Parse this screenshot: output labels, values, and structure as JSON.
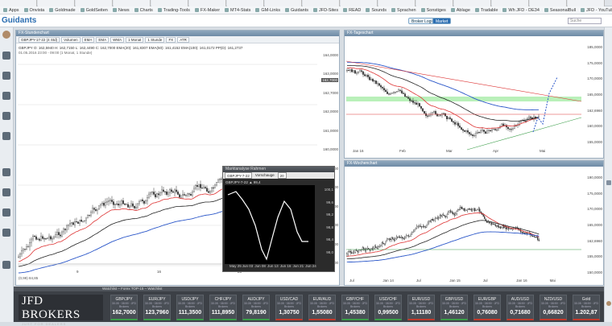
{
  "browser": {
    "tabs": [
      "",
      "",
      "",
      "",
      "",
      "",
      "",
      "",
      "",
      "",
      "",
      "",
      "",
      "",
      "",
      ""
    ],
    "bookmarks": [
      "Apps",
      "Onvista",
      "Goldmade",
      "GoldSeiten",
      "News",
      "Charts",
      "Trading-Tools",
      "FX-Maker",
      "MT4-Stats",
      "GM-Links",
      "Guidants",
      "JFD-Sites",
      "READ",
      "Sounds",
      "Sprachen",
      "Sonstiges",
      "Ablage",
      "Tradable",
      "Wh JFD - DE34",
      "SeasonalBull",
      "JFD - YouTube",
      "Medien - elysee.de"
    ]
  },
  "app": {
    "logo": "Guidants",
    "broker_login": "Broker Login",
    "market_btn": "Market",
    "search_placeholder": "Suche"
  },
  "panels": {
    "hourly": {
      "header": "FX-Stundenchart",
      "toolbar": [
        "GBPJPY-17-22 (4 Std)",
        "Volumen",
        "EMA",
        "EMA",
        "WMA",
        "1 Monat",
        "1 Stunde",
        "FX",
        "ATR"
      ],
      "legend": [
        "GBPJPY O: 162,5940  H: 162,7150  L: 162,4490  C: 162,7000  EMA(20): 161,8307  EMA(50): 161,4152  EMA(100): 161,0172  PP(D): 161,2737",
        "01.05.2016 23:00 - 09:00 (1 Monat, 1 Stunde)"
      ],
      "yaxis": [
        "164,0000",
        "163,0000",
        "162,7000",
        "162,0000",
        "161,0000",
        "160,0000",
        "159,0000",
        "158,0000",
        "157,0000",
        "156,0000",
        "155,0000",
        "154,0000"
      ],
      "xaxis": [
        "9",
        "16",
        "23"
      ],
      "indicator": "(0,99) 84,85",
      "price": "162,7000"
    },
    "daily": {
      "header": "FX-Tageschart",
      "legend": [
        "GBPJPY (FOREX, bid)  O: 161,2760  H: 162,8910  L: 161,2470  C: 162,6960",
        "EMA(20): 158,6093",
        "EMA(50): 158,8152",
        "EMA(100): 161,4105",
        "30.11.2015 - 30.05.2016 (6 Monate, 1 Tag)"
      ],
      "yaxis": [
        "185,0000",
        "175,0000",
        "170,0000",
        "165,0000",
        "162,6960",
        "160,0000",
        "155,0000"
      ],
      "xaxis": [
        "Jan 16",
        "Feb",
        "Mar",
        "Apr",
        "Mai"
      ]
    },
    "weekly": {
      "header": "FX-Wochenchart",
      "legend": [
        "GBPJPY  O: 161,2760  H: 162,8910  L: 161,2470  C: 162,6960",
        "EMA(20): 162,4435",
        "EMA(50): 170,2447",
        "EMA(100): 172,6871",
        "27.05.2013 - 30.05.2016 (3 Jahre, 1 Woche)"
      ],
      "yaxis": [
        "190,0000",
        "175,0000",
        "170,0000",
        "165,0000",
        "162,6960",
        "155,0000",
        "150,0000"
      ],
      "xaxis": [
        "Jul",
        "Jan 14",
        "Jul",
        "Jan 15",
        "Jul",
        "Jan 16",
        "Mai"
      ]
    }
  },
  "popup": {
    "title": "Marktanalyse Rahmen",
    "symbol": "GBPJPY-7-22",
    "label": "Vorschauge",
    "value": "20",
    "series_label": "GBPJPY-7-22  ▲ 99,4",
    "yaxis": [
      "100,1",
      "99,6",
      "99,2",
      "98,8",
      "98,4",
      "98,0"
    ],
    "xaxis": [
      "May 25",
      "Jun 03",
      "Jun 08",
      "Jun 13",
      "Jun 16",
      "Jun 21",
      "Jun 24"
    ]
  },
  "watchlist": {
    "header": "Watchlist – Forex TOP-15 – Watchlist",
    "broker": "JFD BROKERS",
    "tagline": "JUST FOR DEALERS",
    "tiles": [
      {
        "symbol": "GBP/JPY",
        "time": "30.05 · 08:59 · JFD Brokers",
        "value": "162,7000",
        "dir": "up"
      },
      {
        "symbol": "EUR/JPY",
        "time": "30.05 · 08:59 · JFD Brokers",
        "value": "123,7960",
        "dir": "up"
      },
      {
        "symbol": "USD/JPY",
        "time": "30.05 · 08:59 · JFD Brokers",
        "value": "111,3500",
        "dir": "up"
      },
      {
        "symbol": "CHF/JPY",
        "time": "30.05 · 08:59 · JFD Brokers",
        "value": "111,8950",
        "dir": "up"
      },
      {
        "symbol": "AUD/JPY",
        "time": "30.05 · 08:59 · JFD Brokers",
        "value": "79,8190",
        "dir": "up"
      },
      {
        "symbol": "USD/CAD",
        "time": "30.05 · 08:59 · JFD Brokers",
        "value": "1,30750",
        "dir": "dn"
      },
      {
        "symbol": "EUR/AUD",
        "time": "30.05 · 08:59 · JFD Brokers",
        "value": "1,55080",
        "dir": "dn"
      },
      {
        "symbol": "GBP/CHF",
        "time": "30.05 · 08:59 · JFD Brokers",
        "value": "1,45380",
        "dir": "up"
      },
      {
        "symbol": "USD/CHF",
        "time": "30.05 · 08:59 · JFD Brokers",
        "value": "0,99500",
        "dir": "up"
      },
      {
        "symbol": "EUR/USD",
        "time": "30.05 · 08:59 · JFD Brokers",
        "value": "1,11180",
        "dir": "dn"
      },
      {
        "symbol": "GBP/USD",
        "time": "30.05 · 08:59 · JFD Brokers",
        "value": "1,46120",
        "dir": "up"
      },
      {
        "symbol": "EUR/GBP",
        "time": "30.05 · 08:59 · JFD Brokers",
        "value": "0,76080",
        "dir": "dn"
      },
      {
        "symbol": "AUD/USD",
        "time": "30.05 · 08:59 · JFD Brokers",
        "value": "0,71680",
        "dir": "dn"
      },
      {
        "symbol": "NZD/USD",
        "time": "30.05 · 08:59 · JFD Brokers",
        "value": "0,66820",
        "dir": "dn"
      },
      {
        "symbol": "Gold",
        "time": "30.05 · 08:59 · JFD Brokers",
        "value": "1.202,87",
        "dir": "dn"
      }
    ]
  },
  "colors": {
    "ema20": "#d33",
    "ema50": "#222",
    "ema100": "#2b57c9",
    "up": "#3a9d48",
    "down": "#c0392b"
  }
}
